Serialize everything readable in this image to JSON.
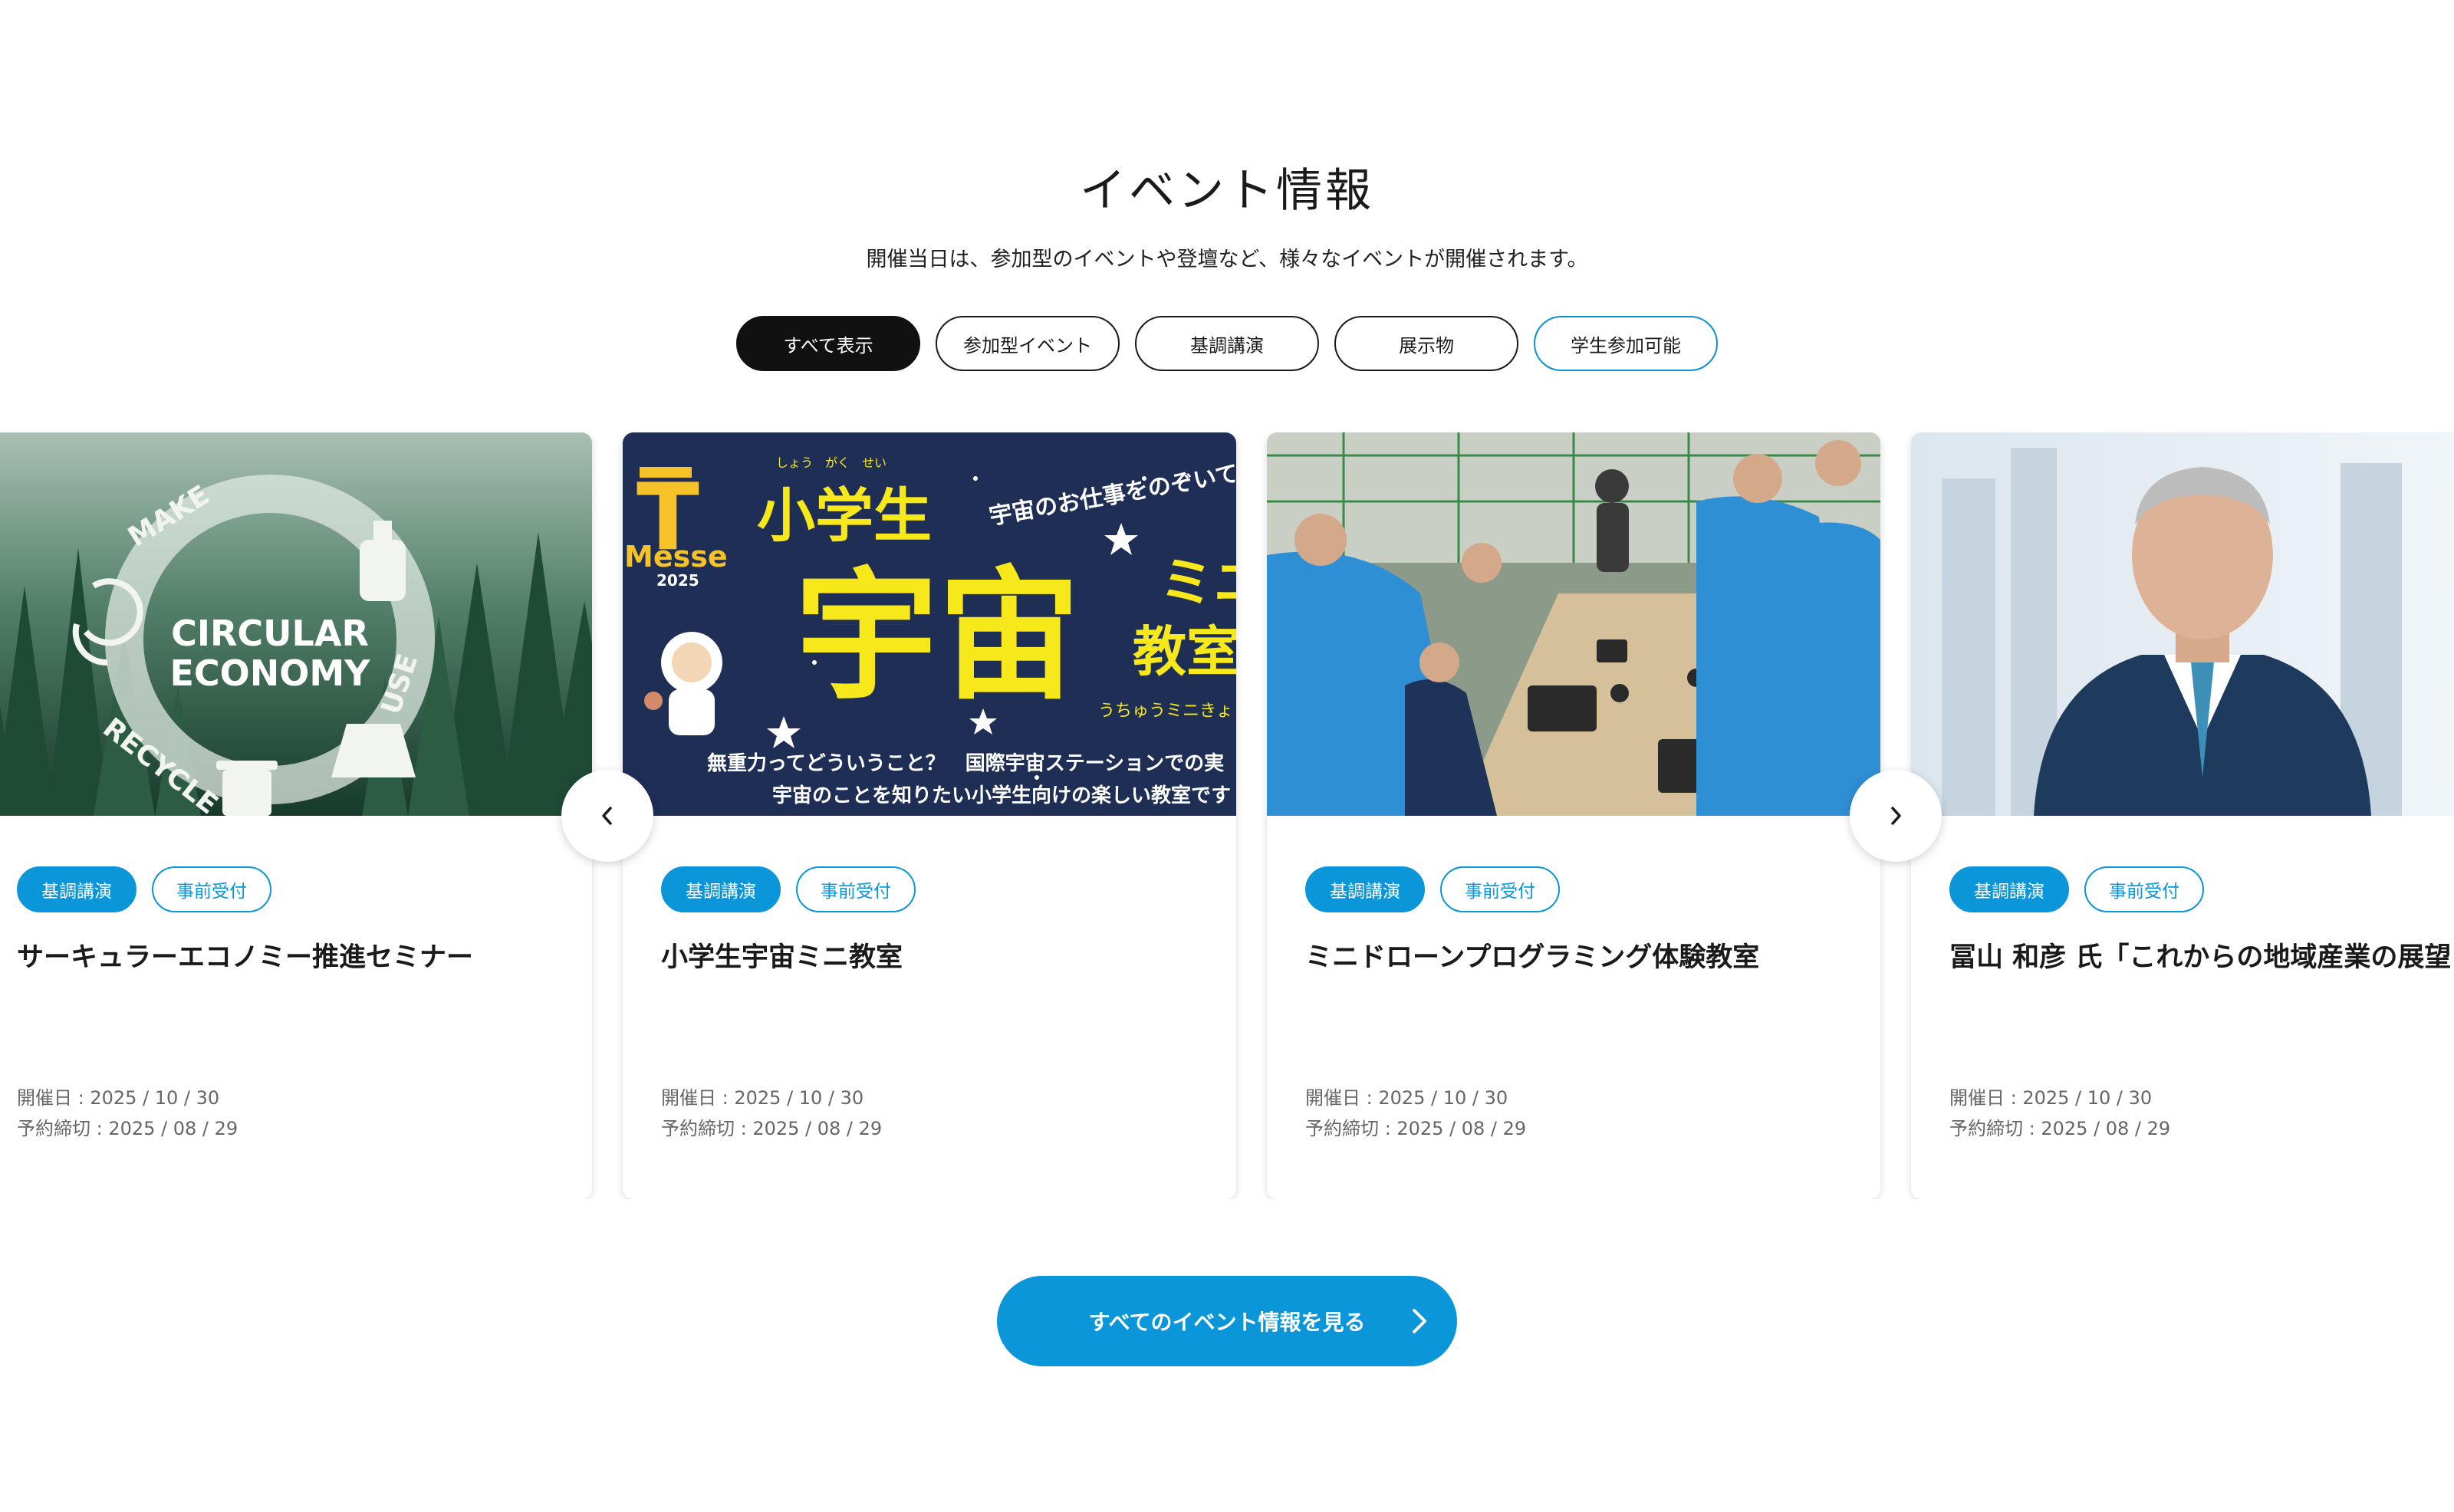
{
  "section": {
    "title": "イベント情報",
    "description": "開催当日は、参加型のイベントや登壇など、様々なイベントが開催されます。"
  },
  "filters": [
    {
      "label": "すべて表示",
      "active": true
    },
    {
      "label": "参加型イベント",
      "active": false
    },
    {
      "label": "基調講演",
      "active": false
    },
    {
      "label": "展示物",
      "active": false
    },
    {
      "label": "学生参加可能",
      "active": false
    }
  ],
  "cards": [
    {
      "tags": [
        "基調講演",
        "事前受付"
      ],
      "title": "サーキュラーエコノミー推進セミナー",
      "date": "開催日 : 2025 / 10 / 30",
      "deadline": "予約締切 : 2025 / 08 / 29",
      "image": {
        "make": "MAKE",
        "use": "USE",
        "recycle": "RECYCLE",
        "line1": "CIRCULAR",
        "line2": "ECONOMY"
      }
    },
    {
      "tags": [
        "基調講演",
        "事前受付"
      ],
      "title": "小学生宇宙ミニ教室",
      "date": "開催日 : 2025 / 10 / 30",
      "deadline": "予約締切 : 2025 / 08 / 29",
      "image": {
        "logo_letter": "T",
        "logo_word": "Messe",
        "logo_year": "2025",
        "headline": "小学生",
        "big": "宇宙",
        "side1": "ミニ",
        "side2": "教室",
        "ruby": "しょう　がく　せい",
        "tagline": "宇宙のお仕事をのぞいてみ",
        "reading": "うちゅうミニきょ",
        "line1": "無重力ってどういうこと？　国際宇宙ステーションでの実",
        "line2": "宇宙のことを知りたい小学生向けの楽しい教室です"
      }
    },
    {
      "tags": [
        "基調講演",
        "事前受付"
      ],
      "title": "ミニドローンプログラミング体験教室",
      "date": "開催日 : 2025 / 10 / 30",
      "deadline": "予約締切 : 2025 / 08 / 29"
    },
    {
      "tags": [
        "基調講演",
        "事前受付"
      ],
      "title": "冨山 和彦 氏「これからの地域産業の展望",
      "date": "開催日 : 2025 / 10 / 30",
      "deadline": "予約締切 : 2025 / 08 / 29"
    }
  ],
  "cta": {
    "label": "すべてのイベント情報を見る"
  },
  "icons": {
    "prev": "chevron-left-icon",
    "next": "chevron-right-icon",
    "cta": "chevron-right-icon"
  },
  "colors": {
    "accent": "#0a96d9",
    "active_filter": "#111111",
    "text": "#1a1a1a",
    "meta": "#666666"
  }
}
